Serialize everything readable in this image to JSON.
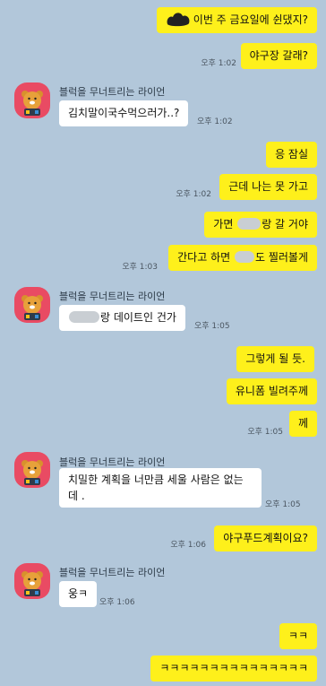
{
  "sender_name": "블럭을 무너트리는 라이언",
  "messages": {
    "m1": {
      "text": "이번 주 금요일에 쉰댔지?"
    },
    "m2": {
      "text": "야구장 갈래?",
      "time": "오후 1:02"
    },
    "m3": {
      "text": "김치말이국수먹으러가..?",
      "time": "오후 1:02"
    },
    "m4": {
      "text": "응 잠실"
    },
    "m5": {
      "text": "근데 나는 못 가고",
      "time": "오후 1:02"
    },
    "m6": {
      "before": "가면",
      "after": "랑 갈 거야"
    },
    "m7": {
      "before": "간다고 하면",
      "after": "도 찔러볼게",
      "time": "오후 1:03"
    },
    "m8": {
      "after": "랑 데이트인 건가",
      "time": "오후 1:05"
    },
    "m9": {
      "text": "그렇게 될 듯."
    },
    "m10": {
      "text": "유니폼 빌려주께"
    },
    "m11": {
      "text": "께",
      "time": "오후 1:05"
    },
    "m12": {
      "text": "치밀한 계획을 너만큼 세울 사람은 없는데 .",
      "time": "오후 1:05"
    },
    "m13": {
      "text": "야구푸드계획이요?",
      "time": "오후 1:06"
    },
    "m14": {
      "text": "웅ㅋ",
      "time": "오후 1:06"
    },
    "m15": {
      "text": "ㅋㅋ"
    },
    "m16": {
      "text": "ㅋㅋㅋㅋㅋㅋㅋㅋㅋㅋㅋㅋㅋㅋㅋ"
    }
  },
  "colors": {
    "background": "#b2c7da",
    "my_bubble": "#fef01b",
    "their_bubble": "#ffffff",
    "avatar_bg": "#e94b63"
  },
  "icons": {
    "avatar": "ryan-character-icon",
    "redacted": "blurred-name"
  }
}
